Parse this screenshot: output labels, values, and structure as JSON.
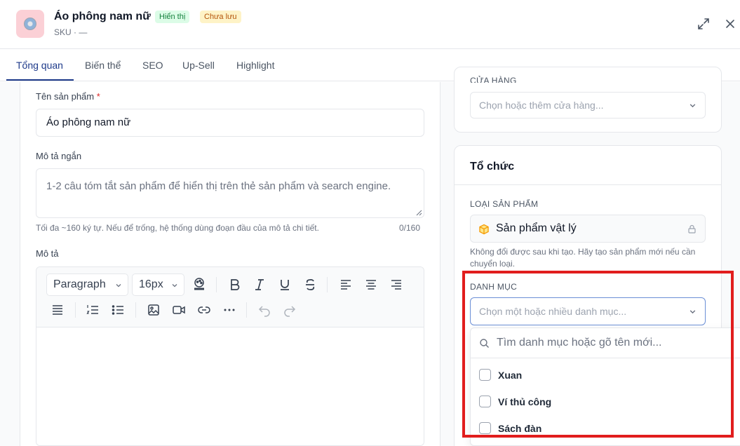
{
  "header": {
    "product_name": "Áo phông nam nữ",
    "badge_visible": "Hiển thị",
    "badge_unsaved": "Chưa lưu",
    "sku": "SKU · —"
  },
  "tabs": [
    {
      "label": "Tổng quan",
      "active": true
    },
    {
      "label": "Biến thể",
      "active": false
    },
    {
      "label": "SEO",
      "active": false
    },
    {
      "label": "Up-Sell",
      "active": false
    },
    {
      "label": "Highlight",
      "active": false
    }
  ],
  "form": {
    "name_label": "Tên sản phẩm",
    "required_mark": "*",
    "name_value": "Áo phông nam nữ",
    "short_desc_label": "Mô tả ngắn",
    "short_desc_placeholder": "1-2 câu tóm tắt sản phẩm để hiển thị trên thẻ sản phẩm và search engine.",
    "short_desc_hint": "Tối đa ~160 ký tự. Nếu để trống, hệ thống dùng đoạn đầu của mô tả chi tiết.",
    "short_desc_counter": "0/160",
    "desc_label": "Mô tả"
  },
  "editor": {
    "paragraph_select": "Paragraph",
    "font_size_select": "16px"
  },
  "store": {
    "label": "CỬA HÀNG",
    "placeholder": "Chọn hoặc thêm cửa hàng..."
  },
  "organization": {
    "title": "Tổ chức",
    "type_label": "LOẠI SẢN PHẨM",
    "type_value": "Sản phẩm vật lý",
    "type_hint": "Không đổi được sau khi tạo. Hãy tạo sản phẩm mới nếu cần chuyển loại.",
    "category_label": "DANH MỤC",
    "category_placeholder": "Chọn một hoặc nhiều danh mục...",
    "search_placeholder": "Tìm danh mục hoặc gõ tên mới...",
    "options": [
      "Xuan",
      "Ví thủ công",
      "Sách đàn"
    ]
  },
  "colors": {
    "accent": "#1e3a8a",
    "highlight_box": "#e11d1d",
    "badge_green": "#15803d",
    "badge_amber": "#b45309"
  }
}
